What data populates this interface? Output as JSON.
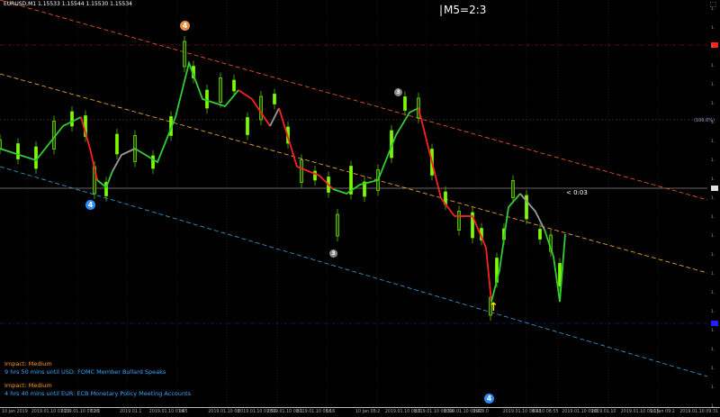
{
  "header": {
    "symbol_info": "EURUSD,M1  1.15533 1.15544 1.15530 1.15534"
  },
  "mode_label": "M5=2:3",
  "countdown": "< 0:03",
  "fib_label": "(100.0%)",
  "news": [
    {
      "impact": "Impact: Medium",
      "text": "9 hrs 50 mins until USD: FOMC Member Bullard Speaks"
    },
    {
      "impact": "Impact: Medium",
      "text": "4 hrs 40 mins until EUR: ECB Monetary Policy Meeting Accounts"
    }
  ],
  "wave_labels": [
    {
      "text": "4",
      "color": "orange"
    },
    {
      "text": "4",
      "color": "blue"
    },
    {
      "text": "3",
      "color": "gray"
    },
    {
      "text": "3",
      "color": "gray"
    },
    {
      "text": "4",
      "color": "blue"
    }
  ],
  "x_axis_labels": [
    "10 Jan 2019",
    "2019.01.10 07:25",
    "2019.01.10 07:26",
    "07:3",
    "2019.01.1",
    "2019.01.10 07:45",
    "16",
    "2019.01.10 08",
    "2019.01.10 07:59",
    "2019.01.10 08:1",
    "2019.01.10 08:16",
    "16",
    "10 Jan 08:2",
    "2019.01.10 08:3",
    "2019.01.10 08:34",
    "2019.01.10 08:42",
    "2019.0",
    "2019.01.10 08:48",
    "01.10 08:55",
    "2019.01.10 09:0",
    "2019.01.10",
    "2019.01.10 09:15",
    "10 Jan 09:2",
    "2019.01.10 09:31"
  ],
  "colors": {
    "background": "#000000",
    "bull_candle": "#7CFC00",
    "bear_candle": "#7CFC00",
    "ma_green": "#32cd32",
    "ma_red": "#ff2020",
    "ma_gray": "#9a9a9a",
    "channel_top": "#ff5a28",
    "channel_mid": "#ffb030",
    "channel_bottom": "#3aa0e0",
    "level_red": "#ff2020",
    "level_blue": "#2020ff"
  }
}
